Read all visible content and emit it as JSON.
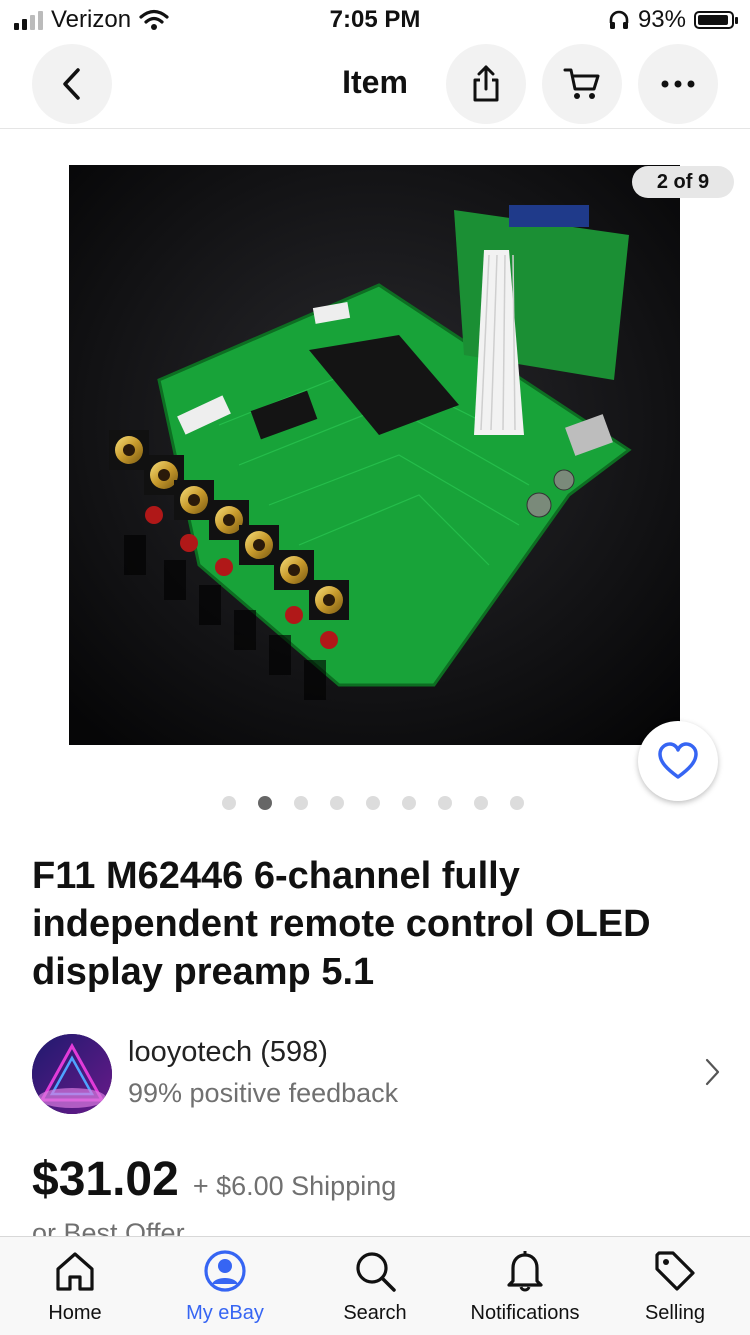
{
  "status_bar": {
    "carrier": "Verizon",
    "time": "7:05 PM",
    "battery": "93%",
    "battery_level": 0.93
  },
  "nav": {
    "title": "Item",
    "icons": [
      "back-icon",
      "share-icon",
      "cart-icon",
      "more-icon"
    ]
  },
  "gallery": {
    "counter": "2 of 9",
    "current_index": 2,
    "total": 9
  },
  "listing": {
    "title": "F11 M62446 6-channel fully independent remote control OLED display preamp 5.1",
    "seller_name": "looyotech (598)",
    "seller_feedback": "99% positive feedback",
    "price": "$31.02",
    "shipping": "+ $6.00 Shipping",
    "offer": "or Best Offer"
  },
  "tabs": [
    {
      "label": "Home",
      "icon": "home-icon",
      "active": false
    },
    {
      "label": "My eBay",
      "icon": "user-icon",
      "active": true
    },
    {
      "label": "Search",
      "icon": "search-icon",
      "active": false
    },
    {
      "label": "Notifications",
      "icon": "bell-icon",
      "active": false
    },
    {
      "label": "Selling",
      "icon": "tag-icon",
      "active": false
    }
  ],
  "colors": {
    "accent": "#3665f3",
    "secondary_text": "#707070"
  }
}
